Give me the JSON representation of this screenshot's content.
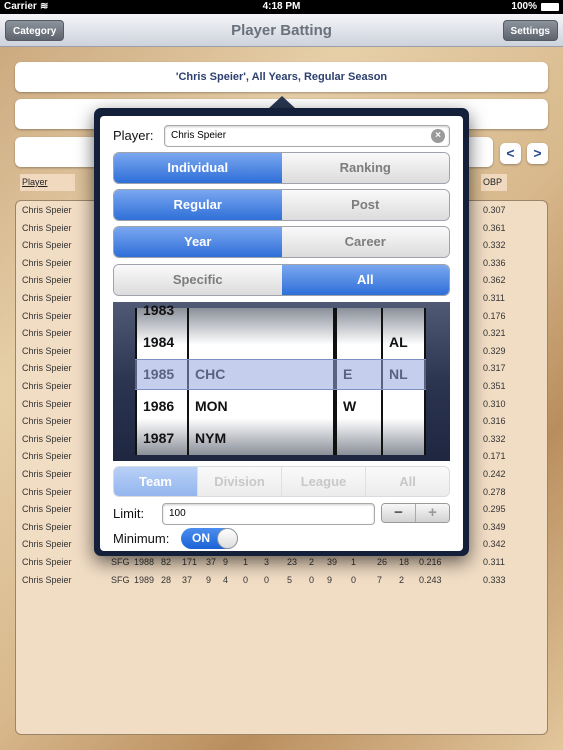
{
  "status": {
    "carrier": "Carrier",
    "time": "4:18 PM",
    "battery": "100%"
  },
  "nav": {
    "left": "Category",
    "title": "Player Batting",
    "right": "Settings"
  },
  "summary": "'Chris Speier', All Years, Regular Season",
  "pager": {
    "prev": "<",
    "next": ">"
  },
  "table": {
    "headers": {
      "player": "Player",
      "obp": "OBP"
    },
    "obp_rows": [
      {
        "player": "Chris Speier",
        "obp": "0.307"
      },
      {
        "player": "Chris Speier",
        "obp": "0.361"
      },
      {
        "player": "Chris Speier",
        "obp": "0.332"
      },
      {
        "player": "Chris Speier",
        "obp": "0.336"
      },
      {
        "player": "Chris Speier",
        "obp": "0.362"
      },
      {
        "player": "Chris Speier",
        "obp": "0.311"
      },
      {
        "player": "Chris Speier",
        "obp": "0.176"
      },
      {
        "player": "Chris Speier",
        "obp": "0.321"
      },
      {
        "player": "Chris Speier",
        "obp": "0.329"
      },
      {
        "player": "Chris Speier",
        "obp": "0.317"
      },
      {
        "player": "Chris Speier",
        "obp": "0.351"
      },
      {
        "player": "Chris Speier",
        "obp": "0.310"
      },
      {
        "player": "Chris Speier",
        "obp": "0.316"
      },
      {
        "player": "Chris Speier",
        "obp": "0.332"
      },
      {
        "player": "Chris Speier",
        "obp": "0.171"
      },
      {
        "player": "Chris Speier",
        "obp": "0.242"
      },
      {
        "player": "Chris Speier",
        "obp": "0.278"
      },
      {
        "player": "Chris Speier",
        "obp": "0.295"
      },
      {
        "player": "Chris Speier",
        "obp": "0.349"
      },
      {
        "player": "Chris Speier",
        "obp": "0.342"
      }
    ],
    "full_rows": [
      [
        "Chris Speier",
        "SFG",
        "1988",
        "82",
        "171",
        "37",
        "9",
        "1",
        "3",
        "23",
        "2",
        "39",
        "1",
        "26",
        "18",
        "0.216",
        "0.311"
      ],
      [
        "Chris Speier",
        "SFG",
        "1989",
        "28",
        "37",
        "9",
        "4",
        "0",
        "0",
        "5",
        "0",
        "9",
        "0",
        "7",
        "2",
        "0.243",
        "0.333"
      ]
    ]
  },
  "popover": {
    "player_label": "Player:",
    "player_value": "Chris Speier",
    "seg1": [
      "Individual",
      "Ranking"
    ],
    "seg2": [
      "Regular",
      "Post"
    ],
    "seg3": [
      "Year",
      "Career"
    ],
    "seg4": [
      "Specific",
      "All"
    ],
    "picker": {
      "years": [
        "1983",
        "1984",
        "1985",
        "1986",
        "1987"
      ],
      "teams": [
        "",
        "",
        "CHC",
        "MON",
        "NYM"
      ],
      "divisions": [
        "",
        "",
        "E",
        "W",
        ""
      ],
      "leagues": [
        "",
        "AL",
        "NL",
        "",
        ""
      ]
    },
    "scope": [
      "Team",
      "Division",
      "League",
      "All"
    ],
    "limit_label": "Limit:",
    "limit_value": "100",
    "stepper": [
      "−",
      "+"
    ],
    "minimum_label": "Minimum:",
    "toggle": "ON"
  }
}
